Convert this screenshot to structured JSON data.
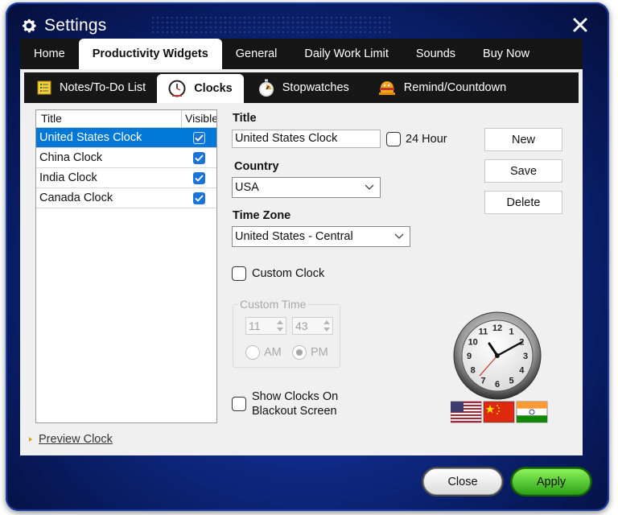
{
  "window": {
    "title": "Settings",
    "icons": {
      "app": "gear-icon",
      "close": "close-icon"
    }
  },
  "main_tabs": [
    {
      "label": "Home",
      "active": false
    },
    {
      "label": "Productivity Widgets",
      "active": true
    },
    {
      "label": "General",
      "active": false
    },
    {
      "label": "Daily Work Limit",
      "active": false
    },
    {
      "label": "Sounds",
      "active": false
    },
    {
      "label": "Buy Now",
      "active": false
    }
  ],
  "sub_tabs": [
    {
      "label": "Notes/To-Do List",
      "icon": "notes-icon",
      "active": false
    },
    {
      "label": "Clocks",
      "icon": "clock-icon",
      "active": true
    },
    {
      "label": "Stopwatches",
      "icon": "stopwatch-icon",
      "active": false
    },
    {
      "label": "Remind/Countdown",
      "icon": "alarm-icon",
      "active": false
    }
  ],
  "clock_list": {
    "headers": {
      "title": "Title",
      "visible": "Visible"
    },
    "rows": [
      {
        "title": "United States Clock",
        "visible": true,
        "selected": true
      },
      {
        "title": "China Clock",
        "visible": true,
        "selected": false
      },
      {
        "title": "India Clock",
        "visible": true,
        "selected": false
      },
      {
        "title": "Canada Clock",
        "visible": true,
        "selected": false
      }
    ]
  },
  "form": {
    "title_label": "Title",
    "title_value": "United States Clock",
    "hour24_label": "24 Hour",
    "hour24_checked": false,
    "country_label": "Country",
    "country_value": "USA",
    "timezone_label": "Time Zone",
    "timezone_value": "United States - Central",
    "custom_clock_label": "Custom Clock",
    "custom_clock_checked": false,
    "custom_time": {
      "legend": "Custom Time",
      "hour": "11",
      "minute": "43",
      "am_label": "AM",
      "pm_label": "PM",
      "pm_selected": true
    },
    "blackout_label_line1": "Show Clocks On",
    "blackout_label_line2": "Blackout Screen",
    "blackout_checked": false
  },
  "side_buttons": {
    "new": "New",
    "save": "Save",
    "delete": "Delete"
  },
  "preview_link": "Preview Clock",
  "clock_art": {
    "numerals": [
      "12",
      "1",
      "2",
      "3",
      "4",
      "5",
      "6",
      "7",
      "8",
      "9",
      "10",
      "11"
    ],
    "flags": [
      "us-flag-icon",
      "china-flag-icon",
      "india-flag-icon"
    ]
  },
  "footer": {
    "close": "Close",
    "apply": "Apply"
  },
  "colors": {
    "accent": "#0078d7",
    "apply_green": "#3cba22",
    "window_blue": "#0f2a86"
  }
}
